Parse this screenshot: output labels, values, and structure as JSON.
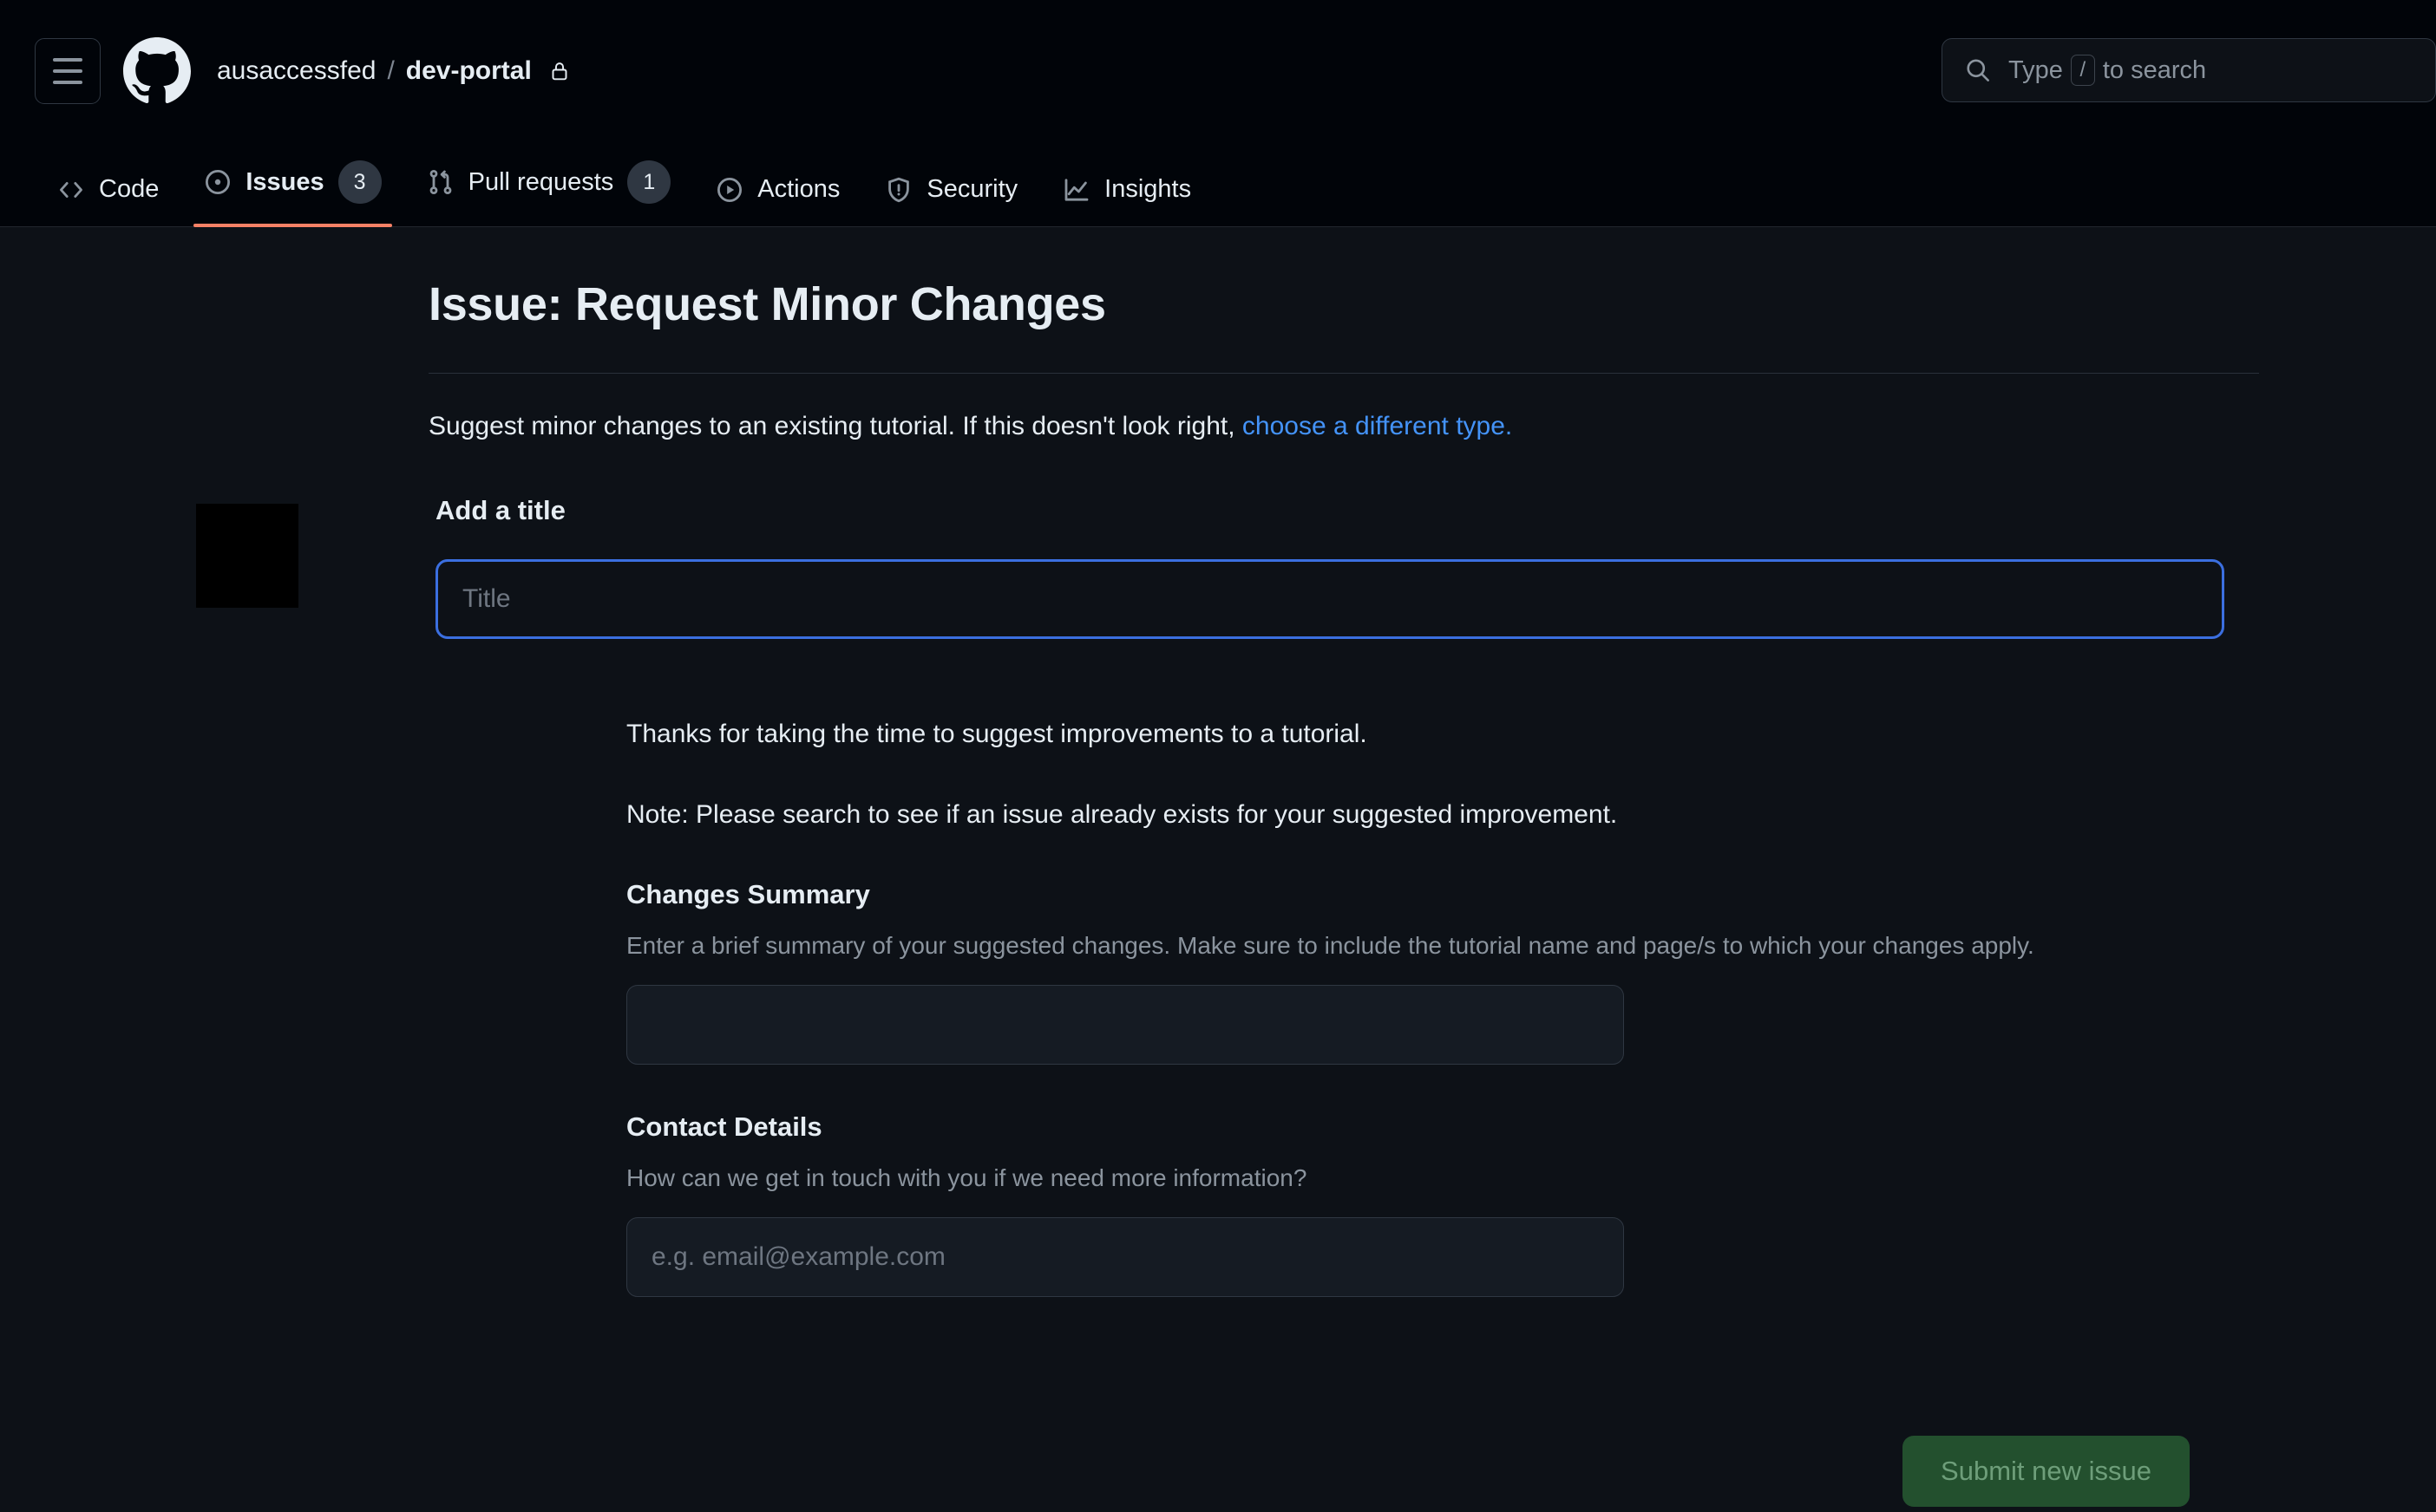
{
  "header": {
    "menu_icon": "hamburger-icon",
    "logo_icon": "github-logo-icon",
    "owner": "ausaccessfed",
    "separator": "/",
    "repo": "dev-portal",
    "visibility_icon": "lock-icon",
    "search": {
      "icon": "search-icon",
      "prefix": "Type",
      "key": "/",
      "suffix": "to search"
    }
  },
  "repo_nav": {
    "tabs": [
      {
        "label": "Code",
        "icon": "code-icon",
        "badge": null,
        "active": false
      },
      {
        "label": "Issues",
        "icon": "issue-opened-icon",
        "badge": "3",
        "active": true
      },
      {
        "label": "Pull requests",
        "icon": "git-pull-request-icon",
        "badge": "1",
        "active": false
      },
      {
        "label": "Actions",
        "icon": "play-circle-icon",
        "badge": null,
        "active": false
      },
      {
        "label": "Security",
        "icon": "shield-icon",
        "badge": null,
        "active": false
      },
      {
        "label": "Insights",
        "icon": "graph-icon",
        "badge": null,
        "active": false
      }
    ],
    "active_accent": "#f78166"
  },
  "main": {
    "page_title": "Issue: Request Minor Changes",
    "subtitle_text": "Suggest minor changes to an existing tutorial. If this doesn't look right, ",
    "subtitle_link": "choose a different type.",
    "avatar": "user-avatar",
    "title_field": {
      "label": "Add a title",
      "placeholder": "Title",
      "value": "",
      "focused": true,
      "focus_color": "#3b6fe0"
    },
    "body_paragraphs": [
      "Thanks for taking the time to suggest improvements to a tutorial.",
      "Note: Please search to see if an issue already exists for your suggested improvement."
    ],
    "sections": [
      {
        "heading": "Changes Summary",
        "description": "Enter a brief summary of your suggested changes. Make sure to include the tutorial name and page/s to which your changes apply.",
        "placeholder": "",
        "value": ""
      },
      {
        "heading": "Contact Details",
        "description": "How can we get in touch with you if we need more information?",
        "placeholder": "e.g. email@example.com",
        "value": ""
      }
    ],
    "submit_label": "Submit new issue",
    "submit_color": "#23502e"
  }
}
